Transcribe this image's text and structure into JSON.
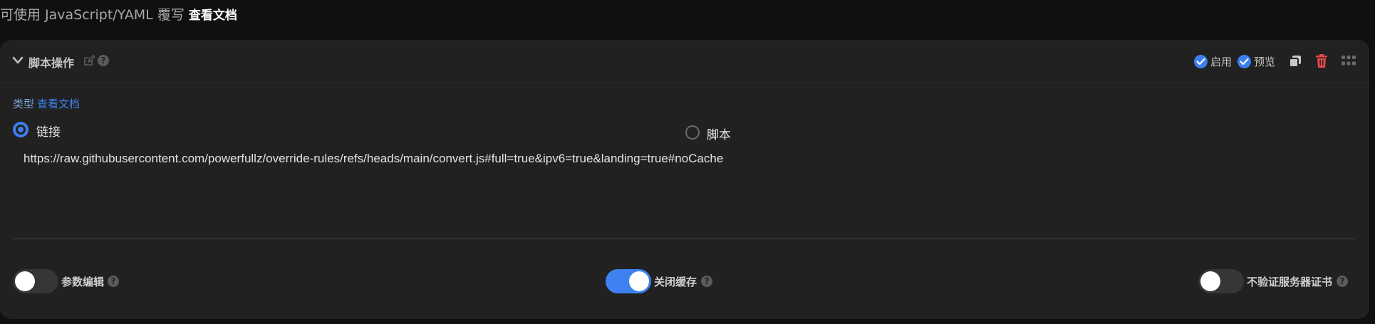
{
  "top": {
    "prefix": "可使用 JavaScript/YAML 覆写",
    "doc_link": "查看文档"
  },
  "header": {
    "title": "脚本操作",
    "enable_label": "启用",
    "preview_label": "预览"
  },
  "type_section": {
    "label": "类型",
    "doc_link": "查看文档",
    "options": [
      {
        "label": "链接",
        "selected": true
      },
      {
        "label": "脚本",
        "selected": false
      }
    ]
  },
  "url_value": "https://raw.githubusercontent.com/powerfullz/override-rules/refs/heads/main/convert.js#full=true&ipv6=true&landing=true#noCache",
  "toggles": [
    {
      "label": "参数编辑",
      "on": false
    },
    {
      "label": "关闭缓存",
      "on": true
    },
    {
      "label": "不验证服务器证书",
      "on": false
    }
  ],
  "colors": {
    "accent": "#3d82f0",
    "danger": "#e5484d",
    "card_bg": "#212121",
    "page_bg": "#101010"
  }
}
